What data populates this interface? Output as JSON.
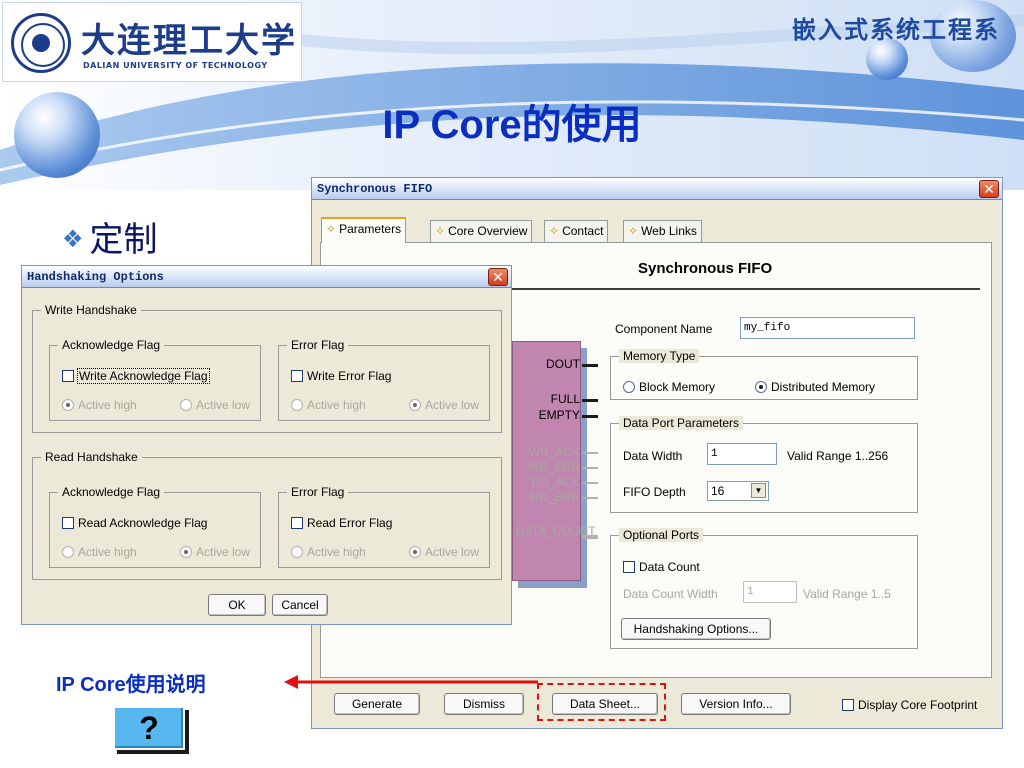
{
  "slide": {
    "logo_cn": "大连理工大学",
    "logo_en": "DALIAN UNIVERSITY OF TECHNOLOGY",
    "dept": "嵌入式系统工程系",
    "title": "IP Core的使用",
    "bullet": "定制",
    "caption": "IP Core使用说明",
    "help_label": "?"
  },
  "fifo_window": {
    "title": "Synchronous FIFO",
    "close": "✕",
    "tabs": [
      {
        "label": "Parameters",
        "active": true
      },
      {
        "label": "Core Overview",
        "active": false
      },
      {
        "label": "Contact",
        "active": false
      },
      {
        "label": "Web Links",
        "active": false
      }
    ],
    "heading": "Synchronous FIFO",
    "symbol_ports": {
      "dout": "DOUT",
      "full": "FULL",
      "empty": "EMPTY",
      "wr_ack": "WR_ACK",
      "wr_err": "WR_ERR",
      "rd_ack": "RD_ACK",
      "rd_err": "RD_ERR",
      "data_count": "DATA_COUNT"
    },
    "component_name_label": "Component Name",
    "component_name_value": "my_fifo",
    "memory_type": {
      "legend": "Memory Type",
      "options": [
        "Block Memory",
        "Distributed Memory"
      ],
      "selected": "Distributed Memory"
    },
    "data_port": {
      "legend": "Data Port Parameters",
      "data_width_label": "Data Width",
      "data_width_value": "1",
      "data_width_range": "Valid Range 1..256",
      "fifo_depth_label": "FIFO Depth",
      "fifo_depth_value": "16"
    },
    "optional_ports": {
      "legend": "Optional Ports",
      "data_count_label": "Data Count",
      "data_count_width_label": "Data Count Width",
      "data_count_width_value": "1",
      "data_count_range": "Valid Range 1..5",
      "handshaking_button": "Handshaking Options..."
    },
    "buttons": {
      "generate": "Generate",
      "dismiss": "Dismiss",
      "data_sheet": "Data Sheet...",
      "version_info": "Version Info..."
    },
    "footprint_label": "Display Core Footprint"
  },
  "handshake_dialog": {
    "title": "Handshaking Options",
    "close": "✕",
    "write_group": "Write Handshake",
    "read_group": "Read Handshake",
    "ack_flag": "Acknowledge Flag",
    "error_flag": "Error Flag",
    "write_ack_checkbox": "Write Acknowledge Flag",
    "write_err_checkbox": "Write Error Flag",
    "read_ack_checkbox": "Read Acknowledge Flag",
    "read_err_checkbox": "Read Error Flag",
    "active_high": "Active high",
    "active_low": "Active low",
    "ok": "OK",
    "cancel": "Cancel"
  },
  "colors": {
    "title_blue": "#0b2ec2",
    "annotation_red": "#e01010",
    "symbol_fill": "#c086b0",
    "window_face": "#ece9d8"
  }
}
